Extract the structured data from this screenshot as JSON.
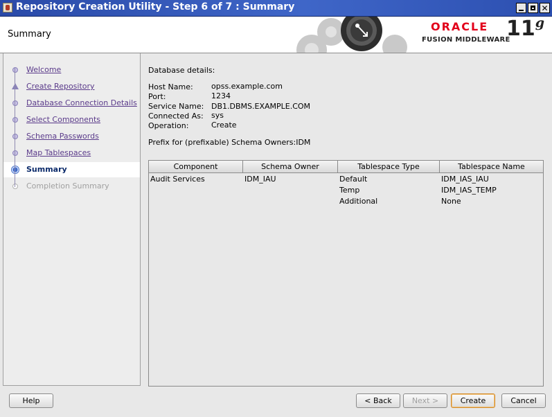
{
  "window": {
    "title": "Repository Creation Utility - Step 6 of 7 : Summary",
    "buttons": {
      "minimize": "minimize",
      "maximize": "maximize",
      "close": "✕"
    }
  },
  "header": {
    "page_title": "Summary",
    "brand": "ORACLE",
    "product": "FUSION MIDDLEWARE",
    "version": "11",
    "version_suffix": "g",
    "colors": {
      "brand": "#e2001a"
    }
  },
  "nav": {
    "items": [
      {
        "label": "Welcome",
        "state": "done"
      },
      {
        "label": "Create Repository",
        "state": "done"
      },
      {
        "label": "Database Connection Details",
        "state": "done"
      },
      {
        "label": "Select Components",
        "state": "done"
      },
      {
        "label": "Schema Passwords",
        "state": "done"
      },
      {
        "label": "Map Tablespaces",
        "state": "done"
      },
      {
        "label": "Summary",
        "state": "current"
      },
      {
        "label": "Completion Summary",
        "state": "disabled"
      }
    ]
  },
  "details": {
    "heading": "Database details:",
    "host_label": "Host Name:",
    "host_value": "opss.example.com",
    "port_label": "Port:",
    "port_value": "1234",
    "service_label": "Service Name:",
    "service_value": "DB1.DBMS.EXAMPLE.COM",
    "connected_label": "Connected As:",
    "connected_value": "sys",
    "operation_label": "Operation:",
    "operation_value": "Create",
    "prefix_text": "Prefix for (prefixable) Schema Owners:IDM"
  },
  "table": {
    "headers": [
      "Component",
      "Schema Owner",
      "Tablespace Type",
      "Tablespace Name"
    ],
    "rows": [
      [
        "Audit Services",
        "IDM_IAU",
        "Default",
        "IDM_IAS_IAU"
      ],
      [
        "",
        "",
        "Temp",
        "IDM_IAS_TEMP"
      ],
      [
        "",
        "",
        "Additional",
        "None"
      ]
    ]
  },
  "buttons": {
    "help": "Help",
    "back": "< Back",
    "next": "Next >",
    "create": "Create",
    "cancel": "Cancel"
  }
}
